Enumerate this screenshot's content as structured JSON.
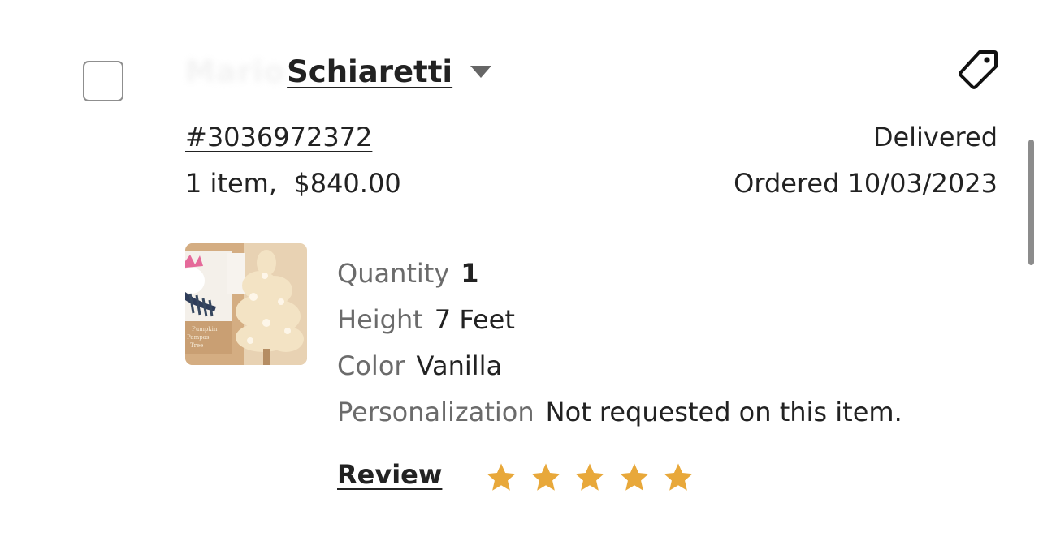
{
  "buyer": {
    "first_name": "Mario",
    "last_name": "Schiaretti",
    "dropdown_icon": "caret-down-icon"
  },
  "actions": {
    "tag_icon": "tag-icon"
  },
  "order": {
    "number": "#3036972372",
    "summary": "1 item,  $840.00",
    "status": "Delivered",
    "ordered": "Ordered 10/03/2023"
  },
  "item": {
    "thumbnail_icon": "product-thumbnail",
    "details": [
      {
        "label": "Quantity",
        "value": "1"
      },
      {
        "label": "Height",
        "value": "7 Feet"
      },
      {
        "label": "Color",
        "value": "Vanilla"
      },
      {
        "label": "Personalization",
        "value": "Not requested on this item."
      }
    ]
  },
  "review": {
    "label": "Review",
    "rating": 5,
    "max": 5,
    "star_color": "#E8A83A"
  },
  "colors": {
    "text": "#222222",
    "muted": "#6B6B6B",
    "checkbox_border": "#8F8F8F"
  }
}
